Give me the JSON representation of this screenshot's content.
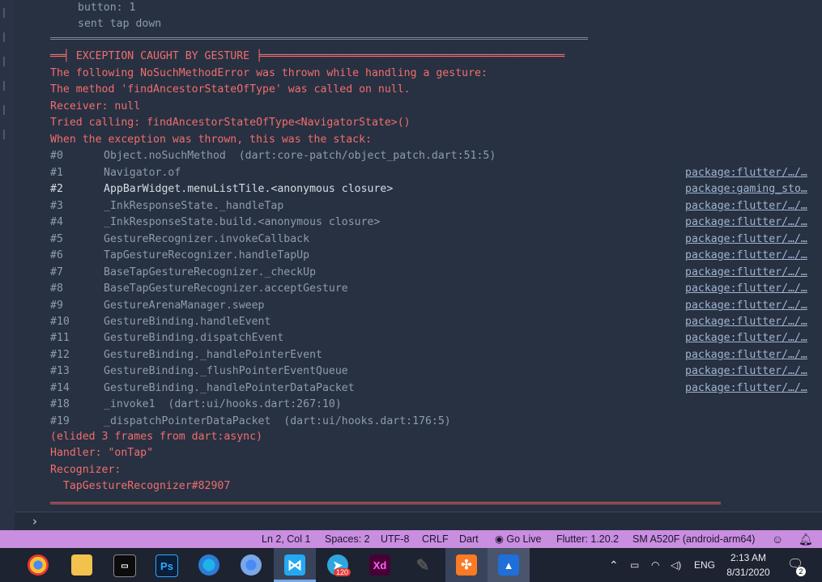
{
  "console": {
    "pre_lines": [
      "button: 1",
      "sent tap down"
    ],
    "exception_header": "══╡ EXCEPTION CAUGHT BY GESTURE ╞═══════════════════════════════════════════════",
    "error_lines": [
      "The following NoSuchMethodError was thrown while handling a gesture:",
      "The method 'findAncestorStateOfType' was called on null.",
      "Receiver: null",
      "Tried calling: findAncestorStateOfType<NavigatorState>()",
      "When the exception was thrown, this was the stack:"
    ],
    "stack": [
      {
        "num": "#0",
        "fn": "Object.noSuchMethod  (dart:core-patch/object_patch.dart:51:5)",
        "pkg": "",
        "bright": false
      },
      {
        "num": "#1",
        "fn": "Navigator.of",
        "pkg": "package:flutter/…/…",
        "bright": false
      },
      {
        "num": "#2",
        "fn": "AppBarWidget.menuListTile.<anonymous closure>",
        "pkg": "package:gaming_sto…",
        "bright": true
      },
      {
        "num": "#3",
        "fn": "_InkResponseState._handleTap",
        "pkg": "package:flutter/…/…",
        "bright": false
      },
      {
        "num": "#4",
        "fn": "_InkResponseState.build.<anonymous closure>",
        "pkg": "package:flutter/…/…",
        "bright": false
      },
      {
        "num": "#5",
        "fn": "GestureRecognizer.invokeCallback",
        "pkg": "package:flutter/…/…",
        "bright": false
      },
      {
        "num": "#6",
        "fn": "TapGestureRecognizer.handleTapUp",
        "pkg": "package:flutter/…/…",
        "bright": false
      },
      {
        "num": "#7",
        "fn": "BaseTapGestureRecognizer._checkUp",
        "pkg": "package:flutter/…/…",
        "bright": false
      },
      {
        "num": "#8",
        "fn": "BaseTapGestureRecognizer.acceptGesture",
        "pkg": "package:flutter/…/…",
        "bright": false
      },
      {
        "num": "#9",
        "fn": "GestureArenaManager.sweep",
        "pkg": "package:flutter/…/…",
        "bright": false
      },
      {
        "num": "#10",
        "fn": "GestureBinding.handleEvent",
        "pkg": "package:flutter/…/…",
        "bright": false
      },
      {
        "num": "#11",
        "fn": "GestureBinding.dispatchEvent",
        "pkg": "package:flutter/…/…",
        "bright": false
      },
      {
        "num": "#12",
        "fn": "GestureBinding._handlePointerEvent",
        "pkg": "package:flutter/…/…",
        "bright": false
      },
      {
        "num": "#13",
        "fn": "GestureBinding._flushPointerEventQueue",
        "pkg": "package:flutter/…/…",
        "bright": false
      },
      {
        "num": "#14",
        "fn": "GestureBinding._handlePointerDataPacket",
        "pkg": "package:flutter/…/…",
        "bright": false
      },
      {
        "num": "#18",
        "fn": "_invoke1  (dart:ui/hooks.dart:267:10)",
        "pkg": "",
        "bright": false
      },
      {
        "num": "#19",
        "fn": "_dispatchPointerDataPacket  (dart:ui/hooks.dart:176:5)",
        "pkg": "",
        "bright": false
      }
    ],
    "tail_lines": [
      "(elided 3 frames from dart:async)",
      "Handler: \"onTap\"",
      "Recognizer:",
      "  TapGestureRecognizer#82907"
    ],
    "prompt": "›"
  },
  "statusbar": {
    "position": "Ln 2, Col 1",
    "spaces": "Spaces: 2",
    "encoding": "UTF-8",
    "eol": "CRLF",
    "language": "Dart",
    "golive": "Go Live",
    "flutter": "Flutter: 1.20.2",
    "device": "SM A520F (android-arm64)"
  },
  "taskbar": {
    "apps": [
      "chrome",
      "file-explorer",
      "terminal",
      "photoshop",
      "edge",
      "chrome-alt",
      "vscode",
      "telegram",
      "adobe-xd",
      "pen-tool",
      "xampp",
      "photos"
    ],
    "telegram_badge": "120",
    "ps_label": "Ps",
    "xd_label": "Xd",
    "lang": "ENG",
    "time": "2:13 AM",
    "date": "8/31/2020",
    "notif_count": "2"
  },
  "colors": {
    "error": "#f26d6d",
    "statusbar": "#c98ee0",
    "background": "#273142"
  }
}
